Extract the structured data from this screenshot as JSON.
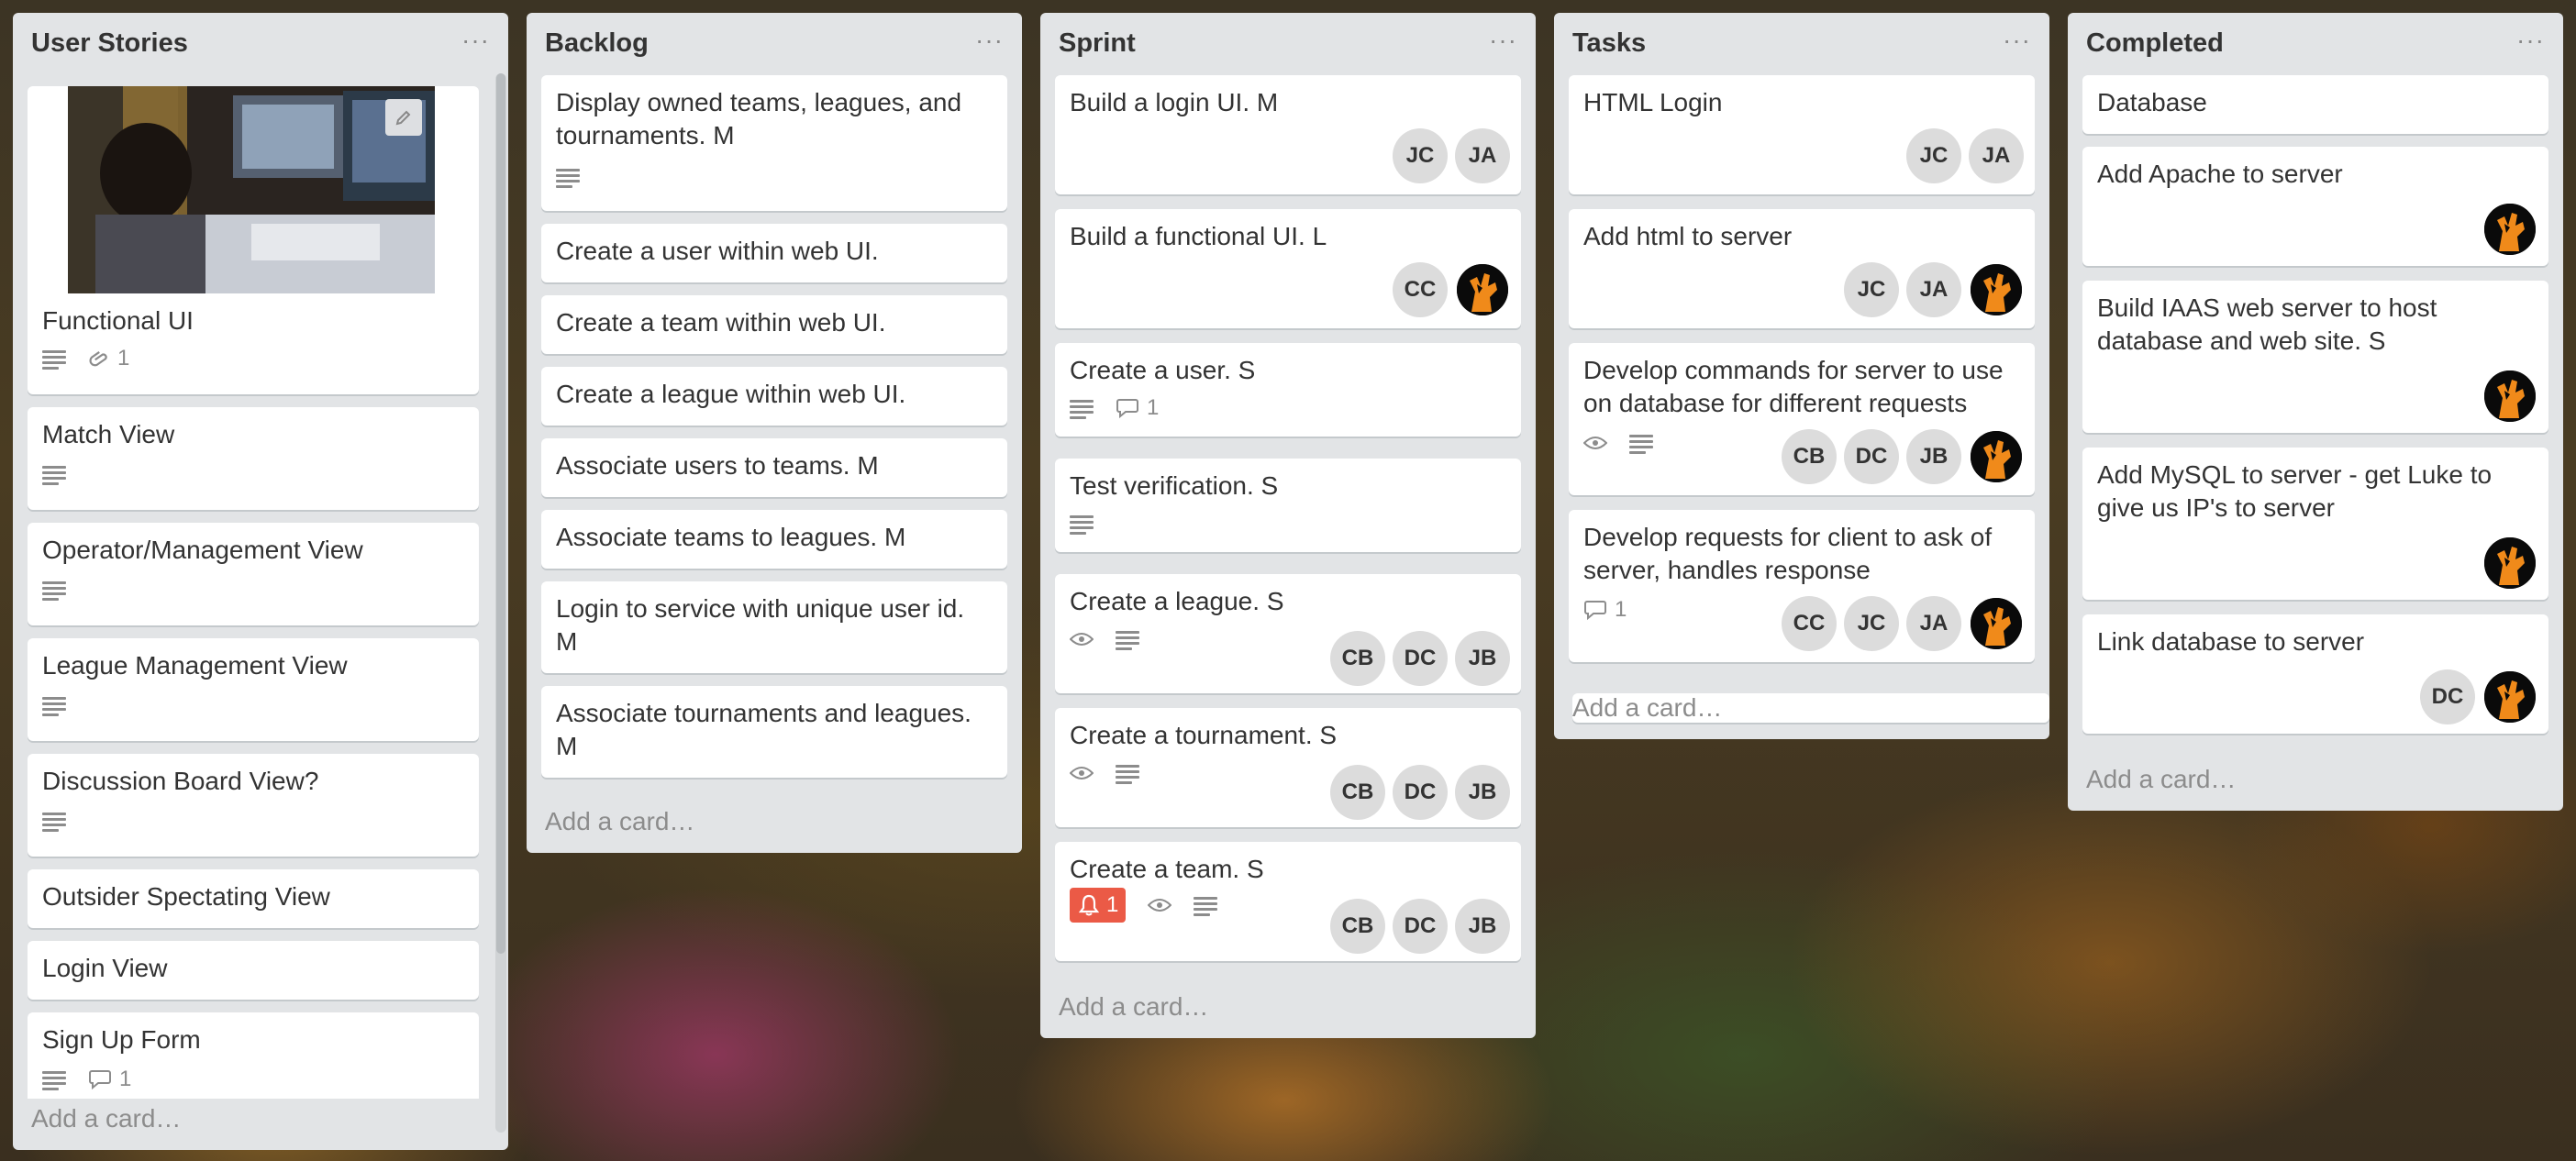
{
  "lists": [
    {
      "title": "User Stories",
      "menu": "···",
      "add_card": "Add a card…",
      "cards": [
        {
          "text": "Functional UI",
          "has_cover": true,
          "badges": {
            "description": true,
            "attachments": "1"
          }
        },
        {
          "text": "Match View",
          "badges": {
            "description": true
          }
        },
        {
          "text": "Operator/Management View",
          "badges": {
            "description": true
          }
        },
        {
          "text": "League Management View",
          "badges": {
            "description": true
          }
        },
        {
          "text": "Discussion Board View?",
          "badges": {
            "description": true
          }
        },
        {
          "text": "Outsider Spectating View"
        },
        {
          "text": "Login View"
        },
        {
          "text": "Sign Up Form",
          "badges": {
            "description": true,
            "comments": "1"
          }
        }
      ]
    },
    {
      "title": "Backlog",
      "menu": "···",
      "add_card": "Add a card…",
      "cards": [
        {
          "text": "Display owned teams, leagues, and tournaments. M",
          "badges": {
            "description": true
          }
        },
        {
          "text": "Create a user within web UI."
        },
        {
          "text": "Create a team within web UI."
        },
        {
          "text": "Create a league within web UI."
        },
        {
          "text": "Associate users to teams. M"
        },
        {
          "text": "Associate teams to leagues. M"
        },
        {
          "text": "Login to service with unique user id. M"
        },
        {
          "text": "Associate tournaments and leagues. M"
        }
      ]
    },
    {
      "title": "Sprint",
      "menu": "···",
      "add_card": "Add a card…",
      "cards": [
        {
          "text": "Build a login UI. M",
          "members": [
            "JC",
            "JA"
          ]
        },
        {
          "text": "Build a functional UI. L",
          "members": [
            "CC",
            "photo"
          ]
        },
        {
          "text": "Create a user. S",
          "badges": {
            "description": true,
            "comments": "1"
          }
        },
        {
          "text": "Test verification. S",
          "badges": {
            "description": true
          }
        },
        {
          "text": "Create a league. S",
          "badges": {
            "watch": true,
            "description": true
          },
          "members": [
            "CB",
            "DC",
            "JB"
          ]
        },
        {
          "text": "Create a tournament. S",
          "badges": {
            "watch": true,
            "description": true
          },
          "members": [
            "CB",
            "DC",
            "JB"
          ]
        },
        {
          "text": "Create a team. S",
          "badges": {
            "due": "1",
            "watch": true,
            "description": true
          },
          "members": [
            "CB",
            "DC",
            "JB"
          ]
        }
      ]
    },
    {
      "title": "Tasks",
      "menu": "···",
      "add_card": "Add a card…",
      "cards": [
        {
          "text": "HTML Login",
          "members": [
            "JC",
            "JA"
          ]
        },
        {
          "text": "Add html to server",
          "members": [
            "JC",
            "JA",
            "photo"
          ]
        },
        {
          "text": "Develop commands for server to use on database for different requests",
          "badges": {
            "watch": true,
            "description": true
          },
          "members": [
            "CB",
            "DC",
            "JB",
            "photo"
          ]
        },
        {
          "text": "Develop requests for client to ask of server, handles response",
          "badges": {
            "comments": "1"
          },
          "members": [
            "CC",
            "JC",
            "JA",
            "photo"
          ]
        }
      ]
    },
    {
      "title": "Completed",
      "menu": "···",
      "add_card": "Add a card…",
      "cards": [
        {
          "text": "Database"
        },
        {
          "text": "Add Apache to server",
          "members": [
            "photo"
          ]
        },
        {
          "text": "Build IAAS web server to host database and web site. S",
          "members": [
            "photo"
          ]
        },
        {
          "text": "Add MySQL to server - get Luke to give us IP's to server",
          "members": [
            "photo"
          ]
        },
        {
          "text": "Link database to server",
          "members": [
            "DC",
            "photo"
          ]
        }
      ]
    }
  ],
  "colors": {
    "list_bg": "#e2e4e6",
    "card_bg": "#ffffff",
    "alert": "#eb5a46",
    "avatar_bg": "#dcdcdc"
  },
  "icons": [
    "description-icon",
    "attachment-icon",
    "comment-icon",
    "watch-icon",
    "bell-icon",
    "pencil-icon",
    "menu-dots-icon"
  ]
}
